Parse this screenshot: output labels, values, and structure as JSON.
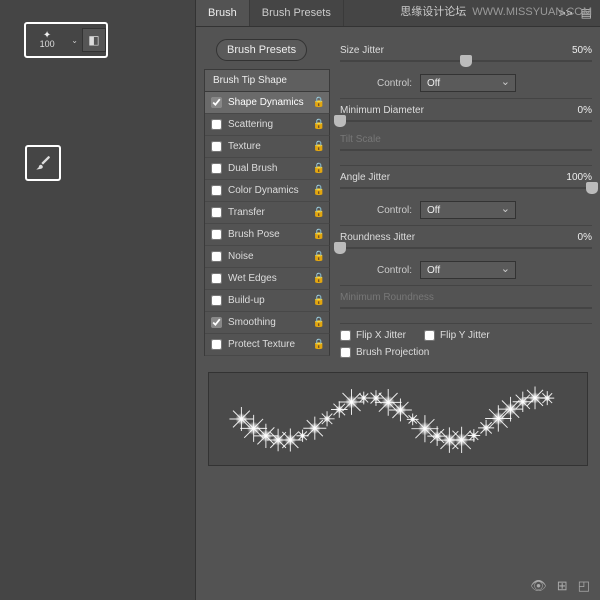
{
  "watermark": {
    "cn": "思缘设计论坛",
    "url": "WWW.MISSYUAN.COM"
  },
  "toolbar": {
    "brush_size": "100"
  },
  "panel": {
    "tabs": [
      "Brush",
      "Brush Presets"
    ],
    "collapse": ">>",
    "presets_btn": "Brush Presets",
    "list_header": "Brush Tip Shape",
    "items": [
      {
        "label": "Shape Dynamics",
        "checked": true,
        "active": true
      },
      {
        "label": "Scattering",
        "checked": false
      },
      {
        "label": "Texture",
        "checked": false
      },
      {
        "label": "Dual Brush",
        "checked": false
      },
      {
        "label": "Color Dynamics",
        "checked": false
      },
      {
        "label": "Transfer",
        "checked": false
      },
      {
        "label": "Brush Pose",
        "checked": false
      },
      {
        "label": "Noise",
        "checked": false
      },
      {
        "label": "Wet Edges",
        "checked": false
      },
      {
        "label": "Build-up",
        "checked": false
      },
      {
        "label": "Smoothing",
        "checked": true
      },
      {
        "label": "Protect Texture",
        "checked": false
      }
    ]
  },
  "controls": {
    "size_jitter": {
      "label": "Size Jitter",
      "value": "50%",
      "pos": 50
    },
    "control1": {
      "label": "Control:",
      "value": "Off"
    },
    "min_diameter": {
      "label": "Minimum Diameter",
      "value": "0%",
      "pos": 0
    },
    "tilt_scale": {
      "label": "Tilt Scale"
    },
    "angle_jitter": {
      "label": "Angle Jitter",
      "value": "100%",
      "pos": 100
    },
    "control2": {
      "label": "Control:",
      "value": "Off"
    },
    "roundness_jitter": {
      "label": "Roundness Jitter",
      "value": "0%",
      "pos": 0
    },
    "control3": {
      "label": "Control:",
      "value": "Off"
    },
    "min_roundness": {
      "label": "Minimum Roundness"
    },
    "flip_x": "Flip X Jitter",
    "flip_y": "Flip Y Jitter",
    "brush_proj": "Brush Projection"
  }
}
